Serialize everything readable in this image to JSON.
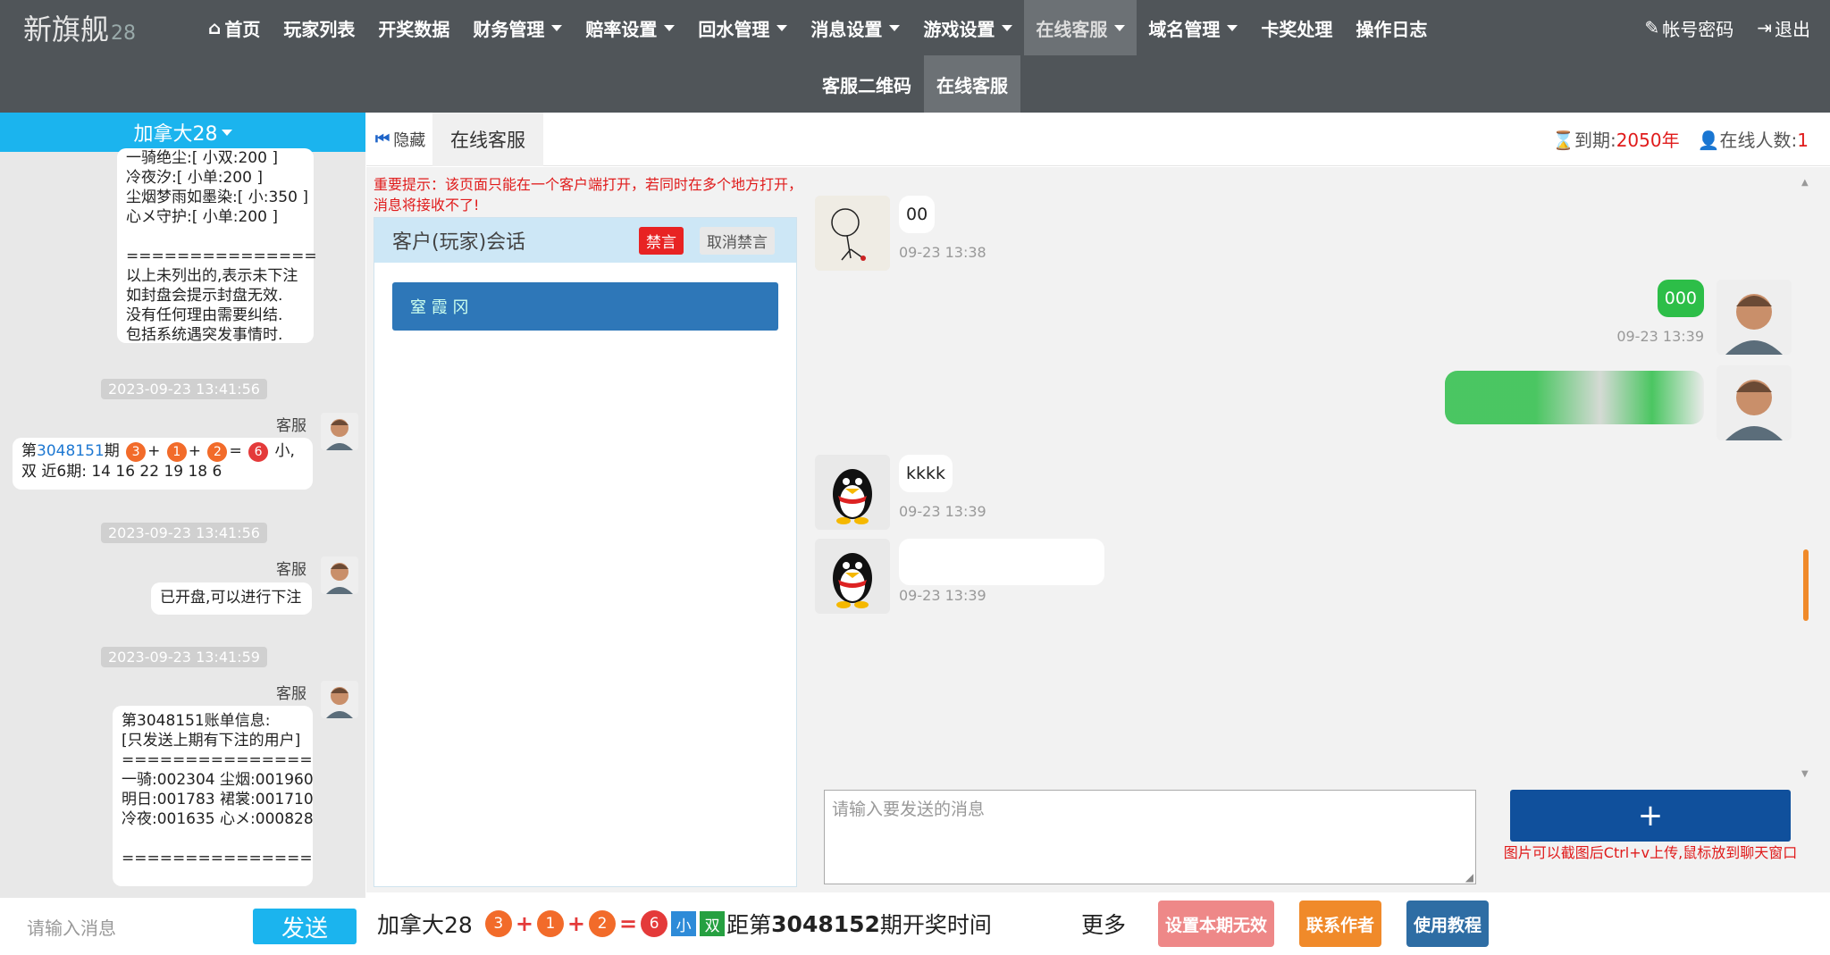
{
  "brand": {
    "name": "新旗舰",
    "suffix": "28"
  },
  "nav": {
    "items": [
      {
        "label": "首页",
        "icon": "home-icon",
        "caret": false,
        "active": false
      },
      {
        "label": "玩家列表",
        "caret": false,
        "active": false
      },
      {
        "label": "开奖数据",
        "caret": false,
        "active": false
      },
      {
        "label": "财务管理",
        "caret": true,
        "active": false
      },
      {
        "label": "赔率设置",
        "caret": true,
        "active": false
      },
      {
        "label": "回水管理",
        "caret": true,
        "active": false
      },
      {
        "label": "消息设置",
        "caret": true,
        "active": false
      },
      {
        "label": "游戏设置",
        "caret": true,
        "active": false
      },
      {
        "label": "在线客服",
        "caret": true,
        "active": true
      },
      {
        "label": "域名管理",
        "caret": true,
        "active": false
      },
      {
        "label": "卡奖处理",
        "caret": false,
        "active": false
      },
      {
        "label": "操作日志",
        "caret": false,
        "active": false
      }
    ],
    "account": "帐号密码",
    "logout": "退出"
  },
  "subnav": {
    "items": [
      {
        "label": "客服二维码",
        "active": false
      },
      {
        "label": "在线客服",
        "active": true
      }
    ]
  },
  "left": {
    "title": "加拿大28",
    "block1": "一骑绝尘:[ 小双:200 ]\n冷夜汐:[ 小单:200 ]\n尘烟梦雨如墨染:[ 小:350 ]\n心メ守护:[ 小单:200 ]\n\n===============\n以上未列出的,表示未下注\n如封盘会提示封盘无效.\n没有任何理由需要纠结.\n包括系统遇突发事情时.",
    "messages": [
      {
        "time": "2023-09-23 13:41:56",
        "sender": "客服",
        "issue_prefix": "第",
        "issue": "3048151",
        "issue_suffix": "期",
        "balls": [
          "3",
          "1",
          "2"
        ],
        "sum": "6",
        "result": "小,",
        "line2": "双 近6期: 14 16 22 19 18 6"
      },
      {
        "time": "2023-09-23 13:41:56",
        "sender": "客服",
        "text": "已开盘,可以进行下注"
      },
      {
        "time": "2023-09-23 13:41:59",
        "sender": "客服",
        "text": "第3048151账单信息:\n[只发送上期有下注的用户]\n===============\n一骑:002304 尘烟:001960\n明日:001783 裙裳:001710\n冷夜:001635 心メ:000828\n\n==============="
      }
    ],
    "input_placeholder": "请输入消息",
    "send_label": "发送"
  },
  "tabbar": {
    "hide_label": "隐藏",
    "tab_label": "在线客服",
    "expire_label": "到期:",
    "expire_value": "2050年",
    "online_label": "在线人数:",
    "online_value": "1"
  },
  "warning": "重要提示：该页面只能在一个客户端打开，若同时在多个地方打开，消息将接收不了!",
  "session": {
    "title": "客户(玩家)会话",
    "ban": "禁言",
    "unban": "取消禁言",
    "player": "窒 霞  冈"
  },
  "chat": [
    {
      "side": "left",
      "avatar": "sketch-avatar",
      "text": "00",
      "time": "09-23 13:38"
    },
    {
      "side": "right",
      "avatar": "agent-avatar",
      "text": "000",
      "time": "09-23 13:39"
    },
    {
      "side": "right",
      "avatar": "agent-avatar",
      "text": "",
      "time": ""
    },
    {
      "side": "left",
      "avatar": "penguin-avatar",
      "text": "kkkk",
      "time": "09-23 13:39"
    },
    {
      "side": "left",
      "avatar": "penguin-avatar",
      "text": "",
      "time": "09-23 13:39"
    }
  ],
  "composer": {
    "placeholder": "请输入要发送的消息",
    "plus": "+",
    "hint": "图片可以截图后Ctrl+v上传,鼠标放到聊天窗口"
  },
  "bottom": {
    "game": "加拿大28",
    "balls": [
      "3",
      "1",
      "2"
    ],
    "sum": "6",
    "size": "小",
    "parity": "双",
    "countdown_prefix": "距第",
    "next_issue": "3048152",
    "countdown_suffix": "期开奖时间",
    "more": "更多",
    "btn_invalid": "设置本期无效",
    "btn_contact": "联系作者",
    "btn_tutorial": "使用教程"
  }
}
